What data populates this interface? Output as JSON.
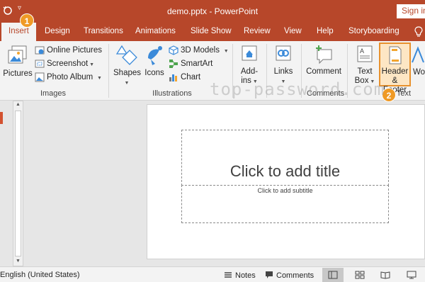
{
  "titlebar": {
    "doc_title": "demo.pptx  -  PowerPoint",
    "sign_in": "Sign in"
  },
  "tabs": [
    {
      "label": "Insert",
      "active": true
    },
    {
      "label": "Design"
    },
    {
      "label": "Transitions"
    },
    {
      "label": "Animations"
    },
    {
      "label": "Slide Show"
    },
    {
      "label": "Review"
    },
    {
      "label": "View"
    },
    {
      "label": "Help"
    },
    {
      "label": "Storyboarding"
    }
  ],
  "ribbon": {
    "images": {
      "label": "Images",
      "pictures": "Pictures",
      "online_pictures": "Online Pictures",
      "screenshot": "Screenshot",
      "photo_album": "Photo Album"
    },
    "illustrations": {
      "label": "Illustrations",
      "shapes": "Shapes",
      "icons": "Icons",
      "models_3d": "3D Models",
      "smartart": "SmartArt",
      "chart": "Chart"
    },
    "addins": {
      "line1": "Add-",
      "line2": "ins"
    },
    "links": "Links",
    "comments": {
      "label": "Comments",
      "comment": "Comment"
    },
    "text": {
      "label": "Text",
      "text_box_1": "Text",
      "text_box_2": "Box",
      "header_1": "Header",
      "header_2": "& Footer",
      "wordart_partial": "Wo"
    }
  },
  "callouts": {
    "step1": "1",
    "step2": "2"
  },
  "watermark": "top-password.com",
  "slide": {
    "title_placeholder": "Click to add title",
    "subtitle_placeholder": "Click to add subtitle"
  },
  "statusbar": {
    "language": "English (United States)",
    "notes": "Notes",
    "comments": "Comments"
  },
  "colors": {
    "accent": "#b7472a",
    "highlight": "#e8912d"
  }
}
